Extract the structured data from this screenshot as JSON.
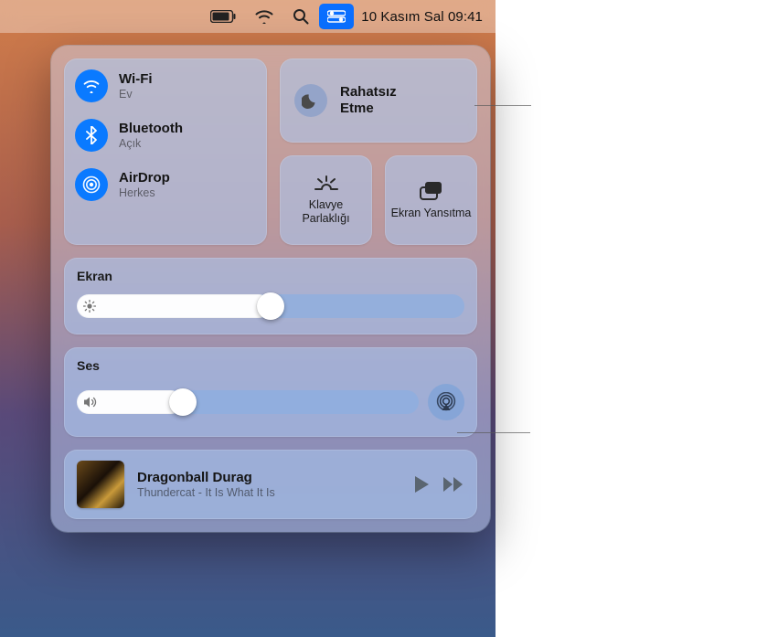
{
  "menubar": {
    "datetime": "10 Kasım Sal  09:41"
  },
  "connectivity": {
    "wifi": {
      "label": "Wi-Fi",
      "status": "Ev"
    },
    "bluetooth": {
      "label": "Bluetooth",
      "status": "Açık"
    },
    "airdrop": {
      "label": "AirDrop",
      "status": "Herkes"
    }
  },
  "dnd": {
    "label": "Rahatsız Etme"
  },
  "keyboard_brightness": {
    "label": "Klavye Parlaklığı"
  },
  "screen_mirroring": {
    "label": "Ekran Yansıtma"
  },
  "display": {
    "title": "Ekran",
    "value_pct": 50
  },
  "sound": {
    "title": "Ses",
    "value_pct": 31
  },
  "now_playing": {
    "title": "Dragonball Durag",
    "subtitle": "Thundercat - It Is What It Is"
  },
  "colors": {
    "accent": "#0a7aff"
  }
}
